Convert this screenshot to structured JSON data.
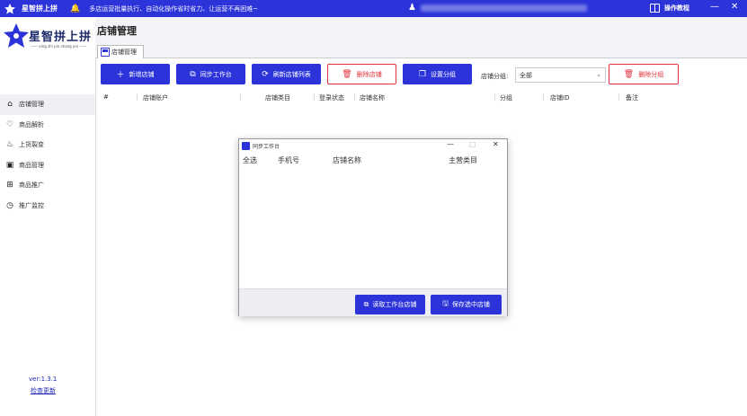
{
  "app": {
    "title": "星智拼上拼",
    "tagline": "多店运营批量执行、自动化操作省时省力、让运营不再困难~",
    "guide_label": "操作教程",
    "min_glyph": "—",
    "close_glyph": "✕",
    "bell_glyph": "🔔",
    "user_glyph": "♟"
  },
  "sidebar": {
    "brand": "星智拼上拼",
    "pinyin": "—— xing zhi pin shang pin ——",
    "items": [
      {
        "label": "店铺管理",
        "icon": "home-icon",
        "glyph": "⌂"
      },
      {
        "label": "商品解析",
        "icon": "heart-icon",
        "glyph": "♡"
      },
      {
        "label": "上货裂变",
        "icon": "flame-icon",
        "glyph": "♨"
      },
      {
        "label": "商品管理",
        "icon": "box-icon",
        "glyph": "▣"
      },
      {
        "label": "商品推广",
        "icon": "grid-icon",
        "glyph": "⊞"
      },
      {
        "label": "推广监控",
        "icon": "clock-icon",
        "glyph": "◷"
      }
    ],
    "version": "ver:1.3.1",
    "update": "检查更新"
  },
  "main": {
    "page_title": "店铺管理",
    "tab_label": "店铺管理",
    "buttons": {
      "add_store": "新增店铺",
      "sync_workbench": "同步工作台",
      "refresh_list": "刷新店铺列表",
      "delete_store": "删除店铺",
      "set_group": "设置分组",
      "delete_group": "删除分组"
    },
    "filter_label": "店铺分组:",
    "filter_value": "全部",
    "columns": [
      "#",
      "店铺账户",
      "店铺类目",
      "登录状态",
      "店铺名称",
      "分组",
      "店铺ID",
      "备注"
    ]
  },
  "dialog": {
    "title": "同步工作台",
    "columns": [
      "全选",
      "手机号",
      "店铺名称",
      "主营类目"
    ],
    "fetch_button": "读取工作台店铺",
    "save_button": "保存选中店铺",
    "min_glyph": "—",
    "max_glyph": "□",
    "close_glyph": "✕"
  },
  "colors": {
    "brand": "#2b33d9",
    "danger": "#e0303a"
  }
}
